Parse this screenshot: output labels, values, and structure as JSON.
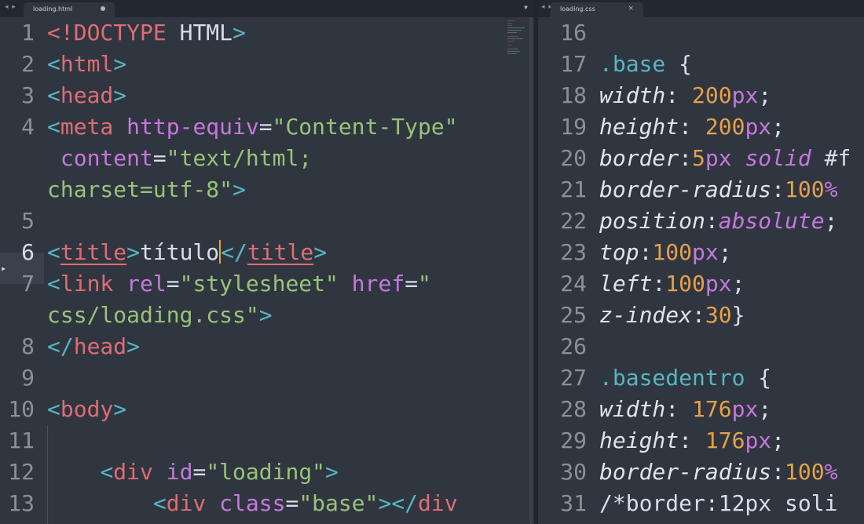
{
  "left_pane": {
    "tab": {
      "nav_arrows": "◂ ▸",
      "label": "loading.html",
      "state_icon": "modified-dot-icon",
      "dropdown": "▼"
    },
    "current_line": "6",
    "lines": [
      {
        "num": "1",
        "tokens": [
          {
            "t": "<!",
            "c": "tag"
          },
          {
            "t": "DOCTYPE",
            "c": "tag"
          },
          {
            "t": " HTML",
            "c": "plain"
          },
          {
            "t": ">",
            "c": "punct"
          }
        ]
      },
      {
        "num": "2",
        "tokens": [
          {
            "t": "<",
            "c": "punct"
          },
          {
            "t": "html",
            "c": "tag"
          },
          {
            "t": ">",
            "c": "punct"
          }
        ]
      },
      {
        "num": "3",
        "tokens": [
          {
            "t": "<",
            "c": "punct"
          },
          {
            "t": "head",
            "c": "tag"
          },
          {
            "t": ">",
            "c": "punct"
          }
        ]
      },
      {
        "num": "4",
        "tokens": [
          {
            "t": "<",
            "c": "punct"
          },
          {
            "t": "meta",
            "c": "tag"
          },
          {
            "t": " ",
            "c": "plain"
          },
          {
            "t": "http-equiv",
            "c": "attr"
          },
          {
            "t": "=",
            "c": "plain"
          },
          {
            "t": "\"Content-Type\"",
            "c": "str"
          }
        ]
      },
      {
        "num": "",
        "tokens": [
          {
            "t": " ",
            "c": "plain"
          },
          {
            "t": "content",
            "c": "attr"
          },
          {
            "t": "=",
            "c": "plain"
          },
          {
            "t": "\"text/html;",
            "c": "str"
          }
        ]
      },
      {
        "num": "",
        "tokens": [
          {
            "t": "charset=utf-8\"",
            "c": "str"
          },
          {
            "t": ">",
            "c": "punct"
          }
        ]
      },
      {
        "num": "5",
        "tokens": []
      },
      {
        "num": "6",
        "tokens": [
          {
            "t": "<",
            "c": "punct"
          },
          {
            "t": "title",
            "c": "tag ul"
          },
          {
            "t": ">",
            "c": "punct"
          },
          {
            "t": "título",
            "c": "plain"
          },
          {
            "t": "",
            "c": "cursor"
          },
          {
            "t": "</",
            "c": "punct"
          },
          {
            "t": "title",
            "c": "tag ul"
          },
          {
            "t": ">",
            "c": "punct"
          }
        ]
      },
      {
        "num": "7",
        "tokens": [
          {
            "t": "<",
            "c": "punct"
          },
          {
            "t": "link",
            "c": "tag"
          },
          {
            "t": " ",
            "c": "plain"
          },
          {
            "t": "rel",
            "c": "attr"
          },
          {
            "t": "=",
            "c": "plain"
          },
          {
            "t": "\"stylesheet\"",
            "c": "str"
          },
          {
            "t": " ",
            "c": "plain"
          },
          {
            "t": "href",
            "c": "attr"
          },
          {
            "t": "=",
            "c": "plain"
          },
          {
            "t": "\"",
            "c": "str"
          }
        ]
      },
      {
        "num": "",
        "tokens": [
          {
            "t": "css/loading.css\"",
            "c": "str"
          },
          {
            "t": ">",
            "c": "punct"
          }
        ]
      },
      {
        "num": "8",
        "tokens": [
          {
            "t": "</",
            "c": "punct"
          },
          {
            "t": "head",
            "c": "tag"
          },
          {
            "t": ">",
            "c": "punct"
          }
        ]
      },
      {
        "num": "9",
        "tokens": []
      },
      {
        "num": "10",
        "tokens": [
          {
            "t": "<",
            "c": "punct"
          },
          {
            "t": "body",
            "c": "tag"
          },
          {
            "t": ">",
            "c": "punct"
          }
        ]
      },
      {
        "num": "11",
        "tokens": []
      },
      {
        "num": "12",
        "tokens": [
          {
            "t": "    ",
            "c": "plain"
          },
          {
            "t": "<",
            "c": "punct"
          },
          {
            "t": "div",
            "c": "tag"
          },
          {
            "t": " ",
            "c": "plain"
          },
          {
            "t": "id",
            "c": "attr"
          },
          {
            "t": "=",
            "c": "plain"
          },
          {
            "t": "\"loading\"",
            "c": "str"
          },
          {
            "t": ">",
            "c": "punct"
          }
        ]
      },
      {
        "num": "13",
        "tokens": [
          {
            "t": "        ",
            "c": "plain"
          },
          {
            "t": "<",
            "c": "punct"
          },
          {
            "t": "div",
            "c": "tag"
          },
          {
            "t": " ",
            "c": "plain"
          },
          {
            "t": "class",
            "c": "attr"
          },
          {
            "t": "=",
            "c": "plain"
          },
          {
            "t": "\"base\"",
            "c": "str"
          },
          {
            "t": "></",
            "c": "punct"
          },
          {
            "t": "div",
            "c": "tag"
          }
        ]
      }
    ]
  },
  "right_pane": {
    "tab": {
      "nav_arrows": "◂ ▸",
      "label": "loading.css",
      "close": "×"
    },
    "lines": [
      {
        "num": "16",
        "tokens": []
      },
      {
        "num": "17",
        "tokens": [
          {
            "t": ".base",
            "c": "sel"
          },
          {
            "t": " {",
            "c": "brace"
          }
        ]
      },
      {
        "num": "18",
        "tokens": [
          {
            "t": "width",
            "c": "prop"
          },
          {
            "t": ": ",
            "c": "plain"
          },
          {
            "t": "200",
            "c": "num"
          },
          {
            "t": "px",
            "c": "unit"
          },
          {
            "t": ";",
            "c": "plain"
          }
        ]
      },
      {
        "num": "19",
        "tokens": [
          {
            "t": "height",
            "c": "prop"
          },
          {
            "t": ": ",
            "c": "plain"
          },
          {
            "t": "200",
            "c": "num"
          },
          {
            "t": "px",
            "c": "unit"
          },
          {
            "t": ";",
            "c": "plain"
          }
        ]
      },
      {
        "num": "20",
        "tokens": [
          {
            "t": "border",
            "c": "prop"
          },
          {
            "t": ":",
            "c": "plain"
          },
          {
            "t": "5",
            "c": "num"
          },
          {
            "t": "px",
            "c": "unit"
          },
          {
            "t": " ",
            "c": "plain"
          },
          {
            "t": "solid",
            "c": "kw"
          },
          {
            "t": " #f",
            "c": "plain"
          }
        ]
      },
      {
        "num": "21",
        "tokens": [
          {
            "t": "border-radius",
            "c": "prop"
          },
          {
            "t": ":",
            "c": "plain"
          },
          {
            "t": "100",
            "c": "num"
          },
          {
            "t": "%",
            "c": "unit"
          }
        ]
      },
      {
        "num": "22",
        "tokens": [
          {
            "t": "position",
            "c": "prop"
          },
          {
            "t": ":",
            "c": "plain"
          },
          {
            "t": "absolute",
            "c": "kw"
          },
          {
            "t": ";",
            "c": "plain"
          }
        ]
      },
      {
        "num": "23",
        "tokens": [
          {
            "t": "top",
            "c": "prop"
          },
          {
            "t": ":",
            "c": "plain"
          },
          {
            "t": "100",
            "c": "num"
          },
          {
            "t": "px",
            "c": "unit"
          },
          {
            "t": ";",
            "c": "plain"
          }
        ]
      },
      {
        "num": "24",
        "tokens": [
          {
            "t": "left",
            "c": "prop"
          },
          {
            "t": ":",
            "c": "plain"
          },
          {
            "t": "100",
            "c": "num"
          },
          {
            "t": "px",
            "c": "unit"
          },
          {
            "t": ";",
            "c": "plain"
          }
        ]
      },
      {
        "num": "25",
        "tokens": [
          {
            "t": "z-index",
            "c": "prop"
          },
          {
            "t": ":",
            "c": "plain"
          },
          {
            "t": "30",
            "c": "num"
          },
          {
            "t": "}",
            "c": "brace"
          }
        ]
      },
      {
        "num": "26",
        "tokens": []
      },
      {
        "num": "27",
        "tokens": [
          {
            "t": ".basedentro",
            "c": "sel"
          },
          {
            "t": " {",
            "c": "brace"
          }
        ]
      },
      {
        "num": "28",
        "tokens": [
          {
            "t": "width",
            "c": "prop"
          },
          {
            "t": ": ",
            "c": "plain"
          },
          {
            "t": "176",
            "c": "num"
          },
          {
            "t": "px",
            "c": "unit"
          },
          {
            "t": ";",
            "c": "plain"
          }
        ]
      },
      {
        "num": "29",
        "tokens": [
          {
            "t": "height",
            "c": "prop"
          },
          {
            "t": ": ",
            "c": "plain"
          },
          {
            "t": "176",
            "c": "num"
          },
          {
            "t": "px",
            "c": "unit"
          },
          {
            "t": ";",
            "c": "plain"
          }
        ]
      },
      {
        "num": "30",
        "tokens": [
          {
            "t": "border-radius",
            "c": "prop"
          },
          {
            "t": ":",
            "c": "plain"
          },
          {
            "t": "100",
            "c": "num"
          },
          {
            "t": "%",
            "c": "unit"
          }
        ]
      },
      {
        "num": "31",
        "tokens": [
          {
            "t": "/*border:12px soli",
            "c": "comment"
          }
        ]
      }
    ]
  },
  "colors": {
    "background": "#303640",
    "tab_bar": "#23272e",
    "tag": "#e06c75",
    "punctuation": "#56b6c2",
    "attribute": "#c678dd",
    "string": "#98c379",
    "number": "#e5a04b",
    "text": "#d8dee9"
  }
}
